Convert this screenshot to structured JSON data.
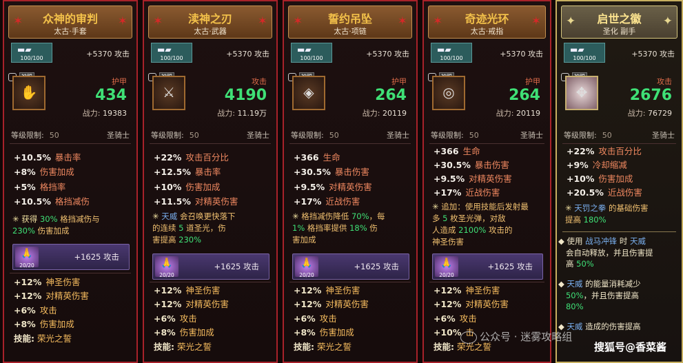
{
  "cards": [
    {
      "name": "众神的审判",
      "sub": "太古·手套",
      "durability": "100/100",
      "top_stat": "+5370 攻击",
      "bound": "神赐",
      "main_label": "护甲",
      "main_value": "434",
      "power_label": "战力:",
      "power_value": "19383",
      "level_label": "等级限制:",
      "level": "50",
      "class": "圣骑士",
      "attrs": [
        {
          "v": "+10.5%",
          "n": "暴击率"
        },
        {
          "v": "+8%",
          "n": "伤害加成"
        },
        {
          "v": "+5%",
          "n": "格挡率"
        },
        {
          "v": "+10.5%",
          "n": "格挡减伤"
        }
      ],
      "special": {
        "p1": "获得",
        "p2": "30%",
        "p3": "格挡减伤与",
        "p4": "230%",
        "p5": "伤害加成"
      },
      "bar_count": "20/20",
      "bar_bonus": "+1625 攻击",
      "bottom": [
        {
          "v": "+12%",
          "n": "神圣伤害"
        },
        {
          "v": "+12%",
          "n": "对精英伤害"
        },
        {
          "v": "+6%",
          "n": "攻击"
        },
        {
          "v": "+8%",
          "n": "伤害加成"
        }
      ],
      "skill_label": "技能:",
      "skill_name": "荣光之誓"
    },
    {
      "name": "渎神之刃",
      "sub": "太古·武器",
      "durability": "100/100",
      "top_stat": "+5370 攻击",
      "bound": "神赐",
      "main_label": "攻击",
      "main_value": "4190",
      "power_label": "战力:",
      "power_value": "11.19万",
      "level_label": "等级限制:",
      "level": "50",
      "class": "圣骑士",
      "attrs": [
        {
          "v": "+22%",
          "n": "攻击百分比"
        },
        {
          "v": "+12.5%",
          "n": "暴击率"
        },
        {
          "v": "+10%",
          "n": "伤害加成"
        },
        {
          "v": "+11.5%",
          "n": "对精英伤害"
        }
      ],
      "special": {
        "p1": "天威",
        "p2": "会召唤更快落下",
        "p3": "的连续",
        "p4": "5",
        "p5": "道圣光，伤",
        "p6": "害提高",
        "p7": "230%"
      },
      "bar_count": "20/20",
      "bar_bonus": "+1625 攻击",
      "bottom": [
        {
          "v": "+12%",
          "n": "神圣伤害"
        },
        {
          "v": "+12%",
          "n": "对精英伤害"
        },
        {
          "v": "+6%",
          "n": "攻击"
        },
        {
          "v": "+8%",
          "n": "伤害加成"
        }
      ],
      "skill_label": "技能:",
      "skill_name": "荣光之誓"
    },
    {
      "name": "誓约吊坠",
      "sub": "太古·项链",
      "durability": "100/100",
      "top_stat": "+5370 攻击",
      "bound": "神赐",
      "main_label": "护甲",
      "main_value": "264",
      "power_label": "战力:",
      "power_value": "20119",
      "level_label": "等级限制:",
      "level": "50",
      "class": "圣骑士",
      "attrs": [
        {
          "v": "+366",
          "n": "生命"
        },
        {
          "v": "+30.5%",
          "n": "暴击伤害"
        },
        {
          "v": "+9.5%",
          "n": "对精英伤害"
        },
        {
          "v": "+17%",
          "n": "近战伤害"
        }
      ],
      "special": {
        "p1": "格挡减伤降低",
        "p2": "70%",
        "p3": "，每",
        "p4": "1%",
        "p5": "格挡率提供",
        "p6": "18%",
        "p7": "伤",
        "p8": "害加成"
      },
      "bar_count": "20/20",
      "bar_bonus": "+1625 攻击",
      "bottom": [
        {
          "v": "+12%",
          "n": "神圣伤害"
        },
        {
          "v": "+12%",
          "n": "对精英伤害"
        },
        {
          "v": "+6%",
          "n": "攻击"
        },
        {
          "v": "+8%",
          "n": "伤害加成"
        }
      ],
      "skill_label": "技能:",
      "skill_name": "荣光之誓"
    },
    {
      "name": "奇迹光环",
      "sub": "太古·戒指",
      "durability": "100/100",
      "top_stat": "+5370 攻击",
      "bound": "神赐",
      "main_label": "护甲",
      "main_value": "264",
      "power_label": "战力:",
      "power_value": "20119",
      "level_label": "等级限制:",
      "level": "50",
      "class": "圣骑士",
      "attrs": [
        {
          "v": "+366",
          "n": "生命"
        },
        {
          "v": "+30.5%",
          "n": "暴击伤害"
        },
        {
          "v": "+9.5%",
          "n": "对精英伤害"
        },
        {
          "v": "+17%",
          "n": "近战伤害"
        }
      ],
      "special": {
        "p1": "追加：使用技能后发射最",
        "p2": "多",
        "p3": "5",
        "p4": "枚圣光弹，对敌",
        "p5": "人造成",
        "p6": "2100%",
        "p7": "攻击的",
        "p8": "神圣伤害"
      },
      "bar_count": "20/20",
      "bar_bonus": "+1625 攻击",
      "bottom": [
        {
          "v": "+12%",
          "n": "神圣伤害"
        },
        {
          "v": "+12%",
          "n": "对精英伤害"
        },
        {
          "v": "+6%",
          "n": "攻击"
        },
        {
          "v": "+10%",
          "n": "击"
        }
      ],
      "skill_label": "技能:",
      "skill_name": "荣光之誓"
    },
    {
      "name": "启世之徽",
      "sub": "圣化 副手",
      "durability": "100/100",
      "top_stat": "+5370 攻击",
      "bound": "神赐",
      "main_label": "攻击",
      "main_value": "2676",
      "power_label": "战力:",
      "power_value": "76729",
      "level_label": "等级限制:",
      "level": "50",
      "class": "圣骑士",
      "attrs": [
        {
          "v": "+22%",
          "n": "攻击百分比"
        },
        {
          "v": "+9%",
          "n": "冷却缩减"
        },
        {
          "v": "+10%",
          "n": "伤害加成"
        },
        {
          "v": "+20.5%",
          "n": "近战伤害"
        }
      ],
      "special": {
        "p1": "天罚之拳",
        "p2": "的基础伤害",
        "p3": "提高",
        "p4": "180%"
      },
      "extra": [
        {
          "a": "使用",
          "b": "战马冲锋",
          "c": "时",
          "d": "天威",
          "e": "会自动释放，并且伤害提",
          "f": "高",
          "g": "50%"
        },
        {
          "a": "天威",
          "b": "的能量消耗减少",
          "c": "50%",
          "d": "，并且伤害提高",
          "e": "80%"
        },
        {
          "a": "天威",
          "b": "造成的伤害提高"
        }
      ]
    }
  ],
  "watermarks": {
    "wechat": "公众号 · 迷雾攻略组",
    "sohu": "搜狐号@香菜酱"
  }
}
